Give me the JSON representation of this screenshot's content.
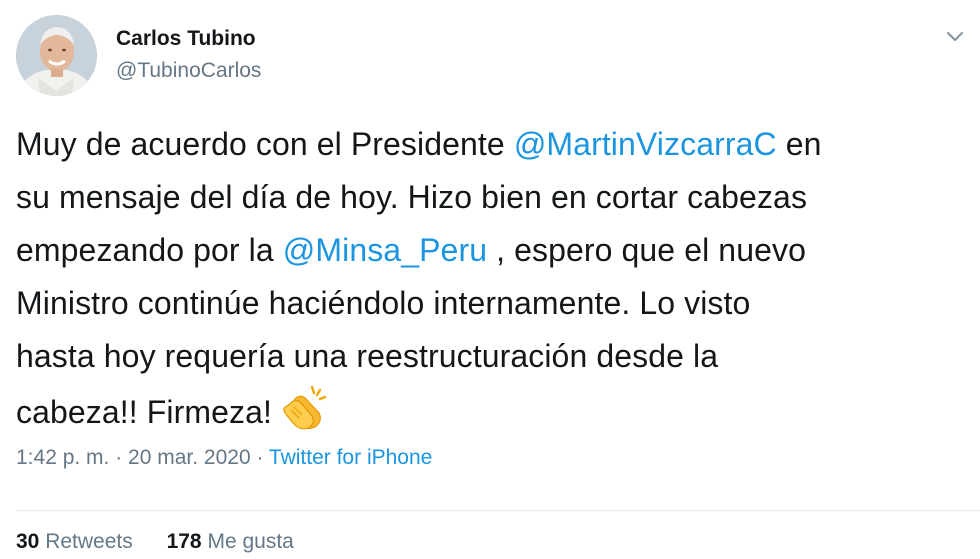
{
  "author": {
    "name": "Carlos Tubino",
    "handle": "@TubinoCarlos"
  },
  "tweet": {
    "l1_a": "Muy de acuerdo con el Presidente ",
    "l1_mention": "@MartinVizcarraC",
    "l1_b": " en",
    "l2": "su mensaje del día de hoy. Hizo bien en cortar cabezas",
    "l3_a": "empezando por la ",
    "l3_mention": "@Minsa_Peru",
    "l3_b": " , espero que el nuevo",
    "l4": "Ministro continúe haciéndolo internamente. Lo visto",
    "l5": "hasta hoy requería una reestructuración desde la",
    "l6": "cabeza!! Firmeza! ",
    "emoji": "clapping-hands"
  },
  "meta": {
    "time": "1:42 p. m. · 20 mar. 2020 · ",
    "source": "Twitter for iPhone"
  },
  "stats": {
    "retweets_count": "30",
    "retweets_label": " Retweets",
    "likes_count": "178",
    "likes_label": " Me gusta"
  },
  "colors": {
    "link": "#1b95e0",
    "secondary": "#657786",
    "text": "#14171a"
  }
}
